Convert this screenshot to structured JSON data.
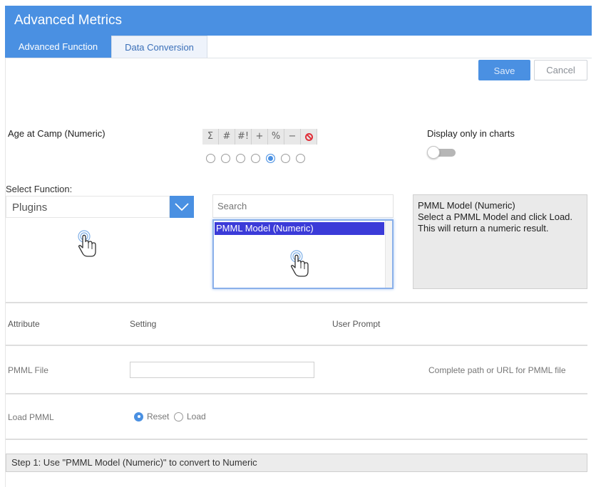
{
  "header": {
    "title": "Advanced Metrics"
  },
  "tabs": [
    {
      "label": "Advanced Function",
      "active": true
    },
    {
      "label": "Data Conversion",
      "active": false
    }
  ],
  "actions": {
    "save_label": "Save",
    "cancel_label": "Cancel"
  },
  "field": {
    "name": "Age at Camp (Numeric)"
  },
  "format_toolbar": {
    "buttons": [
      "Σ",
      "#",
      "#!",
      "+",
      "%",
      "−"
    ],
    "clear_icon": "no-entry-icon",
    "radio_count": 7,
    "selected_index": 4
  },
  "display_only_charts": {
    "label": "Display only in charts",
    "on": false
  },
  "function_select": {
    "label": "Select Function:",
    "value": "Plugins"
  },
  "search": {
    "placeholder": "Search"
  },
  "function_list": {
    "selected_item": "PMML Model (Numeric)"
  },
  "description": {
    "title": "PMML Model (Numeric)",
    "text": "Select a PMML Model and click Load. This will return a numeric result."
  },
  "table": {
    "headers": {
      "attribute": "Attribute",
      "setting": "Setting",
      "user_prompt": "User Prompt"
    },
    "rows": {
      "pmml_file": {
        "label": "PMML File",
        "value": "",
        "hint": "Complete path or URL for PMML file"
      },
      "load_pmml": {
        "label": "Load PMML",
        "options": [
          "Reset",
          "Load"
        ],
        "selected": "Reset"
      }
    }
  },
  "step_text": "Step 1: Use \"PMML Model (Numeric)\" to convert to Numeric",
  "colors": {
    "accent": "#4a90e2",
    "list_selection": "#3b3bd8",
    "danger": "#e0303a"
  }
}
